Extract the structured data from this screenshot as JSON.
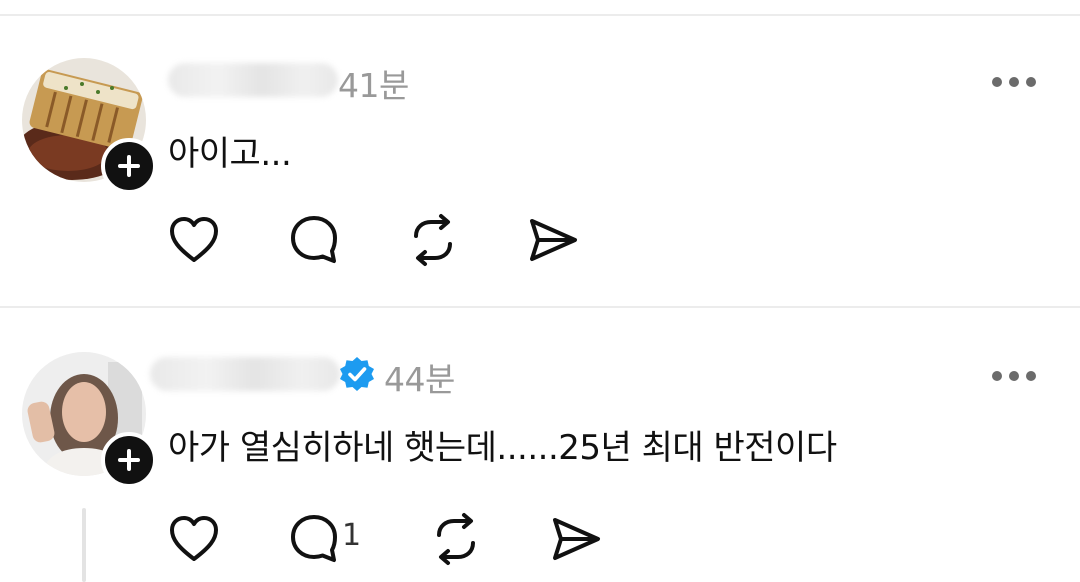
{
  "posts": [
    {
      "timestamp": "41분",
      "text": "아이고...",
      "avatar_icon": "food-photo-avatar",
      "verified": false,
      "reply_count": ""
    },
    {
      "timestamp": "44분",
      "text": "아가 열심히하네 햇는데......25년 최대 반전이다",
      "avatar_icon": "person-photo-avatar",
      "verified": true,
      "reply_count": "1"
    }
  ],
  "icons": {
    "like": "heart-icon",
    "reply": "comment-bubble-icon",
    "repost": "repost-icon",
    "share": "send-icon",
    "follow": "plus-icon",
    "more": "more-dots-icon",
    "verified": "verified-badge-icon"
  },
  "colors": {
    "verified_badge": "#1d9bf0",
    "timestamp": "#999999",
    "divider": "#ececec"
  }
}
